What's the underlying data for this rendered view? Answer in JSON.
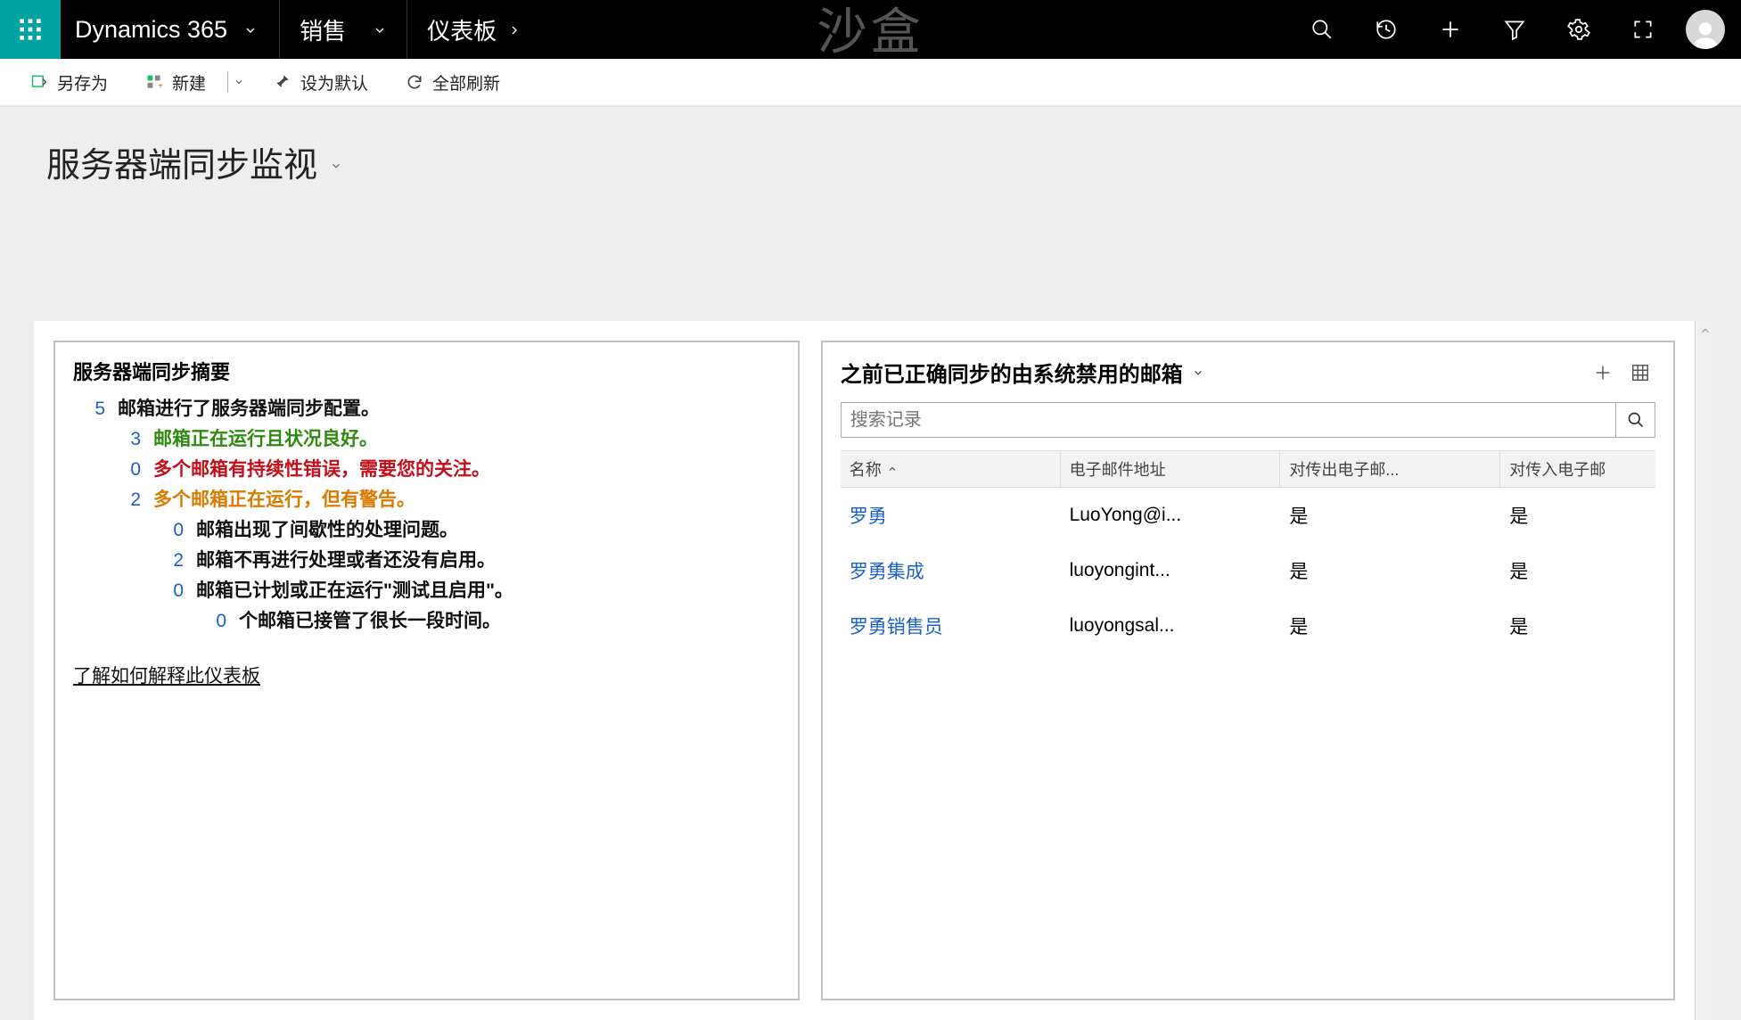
{
  "topbar": {
    "brand": "Dynamics 365",
    "nav_area": "销售",
    "nav_sub": "仪表板",
    "watermark": "沙盒"
  },
  "cmdbar": {
    "save_as": "另存为",
    "new": "新建",
    "set_default": "设为默认",
    "refresh_all": "全部刷新"
  },
  "page": {
    "title": "服务器端同步监视"
  },
  "left_panel": {
    "title": "服务器端同步摘要",
    "root_count": "5",
    "root_text": "邮箱进行了服务器端同步配置。",
    "l1": [
      {
        "count": "3",
        "text": "邮箱正在运行且状况良好。",
        "cls": "green"
      },
      {
        "count": "0",
        "text": "多个邮箱有持续性错误，需要您的关注。",
        "cls": "red"
      },
      {
        "count": "2",
        "text": "多个邮箱正在运行，但有警告。",
        "cls": "orange"
      }
    ],
    "l2": [
      {
        "count": "0",
        "text": "邮箱出现了间歇性的处理问题。"
      },
      {
        "count": "2",
        "text": "邮箱不再进行处理或者还没有启用。"
      },
      {
        "count": "0",
        "text": "邮箱已计划或正在运行\"测试且启用\"。"
      }
    ],
    "l3": {
      "count": "0",
      "text": "个邮箱已接管了很长一段时间。"
    },
    "learn_link": "了解如何解释此仪表板"
  },
  "right_panel": {
    "title": "之前已正确同步的由系统禁用的邮箱",
    "search_placeholder": "搜索记录",
    "columns": {
      "c1": "名称",
      "c2": "电子邮件地址",
      "c3": "对传出电子邮...",
      "c4": "对传入电子邮"
    },
    "rows": [
      {
        "name": "罗勇",
        "email": "LuoYong@i...",
        "out": "是",
        "in": "是"
      },
      {
        "name": "罗勇集成",
        "email": "luoyongint...",
        "out": "是",
        "in": "是"
      },
      {
        "name": "罗勇销售员",
        "email": "luoyongsal...",
        "out": "是",
        "in": "是"
      }
    ]
  }
}
